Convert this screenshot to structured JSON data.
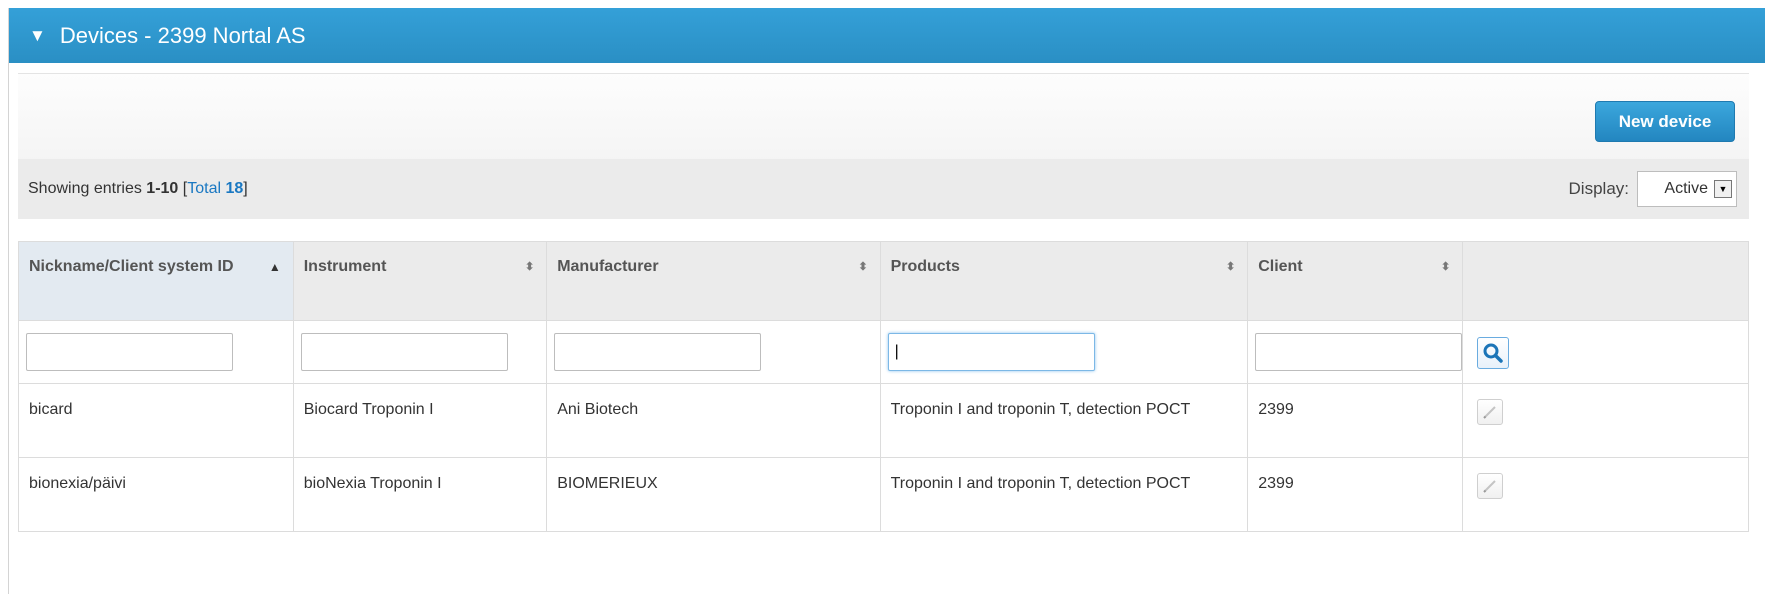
{
  "panel": {
    "title": "Devices - 2399 Nortal AS"
  },
  "toolbar": {
    "new_device_label": "New device"
  },
  "info": {
    "showing_prefix": "Showing entries ",
    "range": "1-10",
    "total_open": " [",
    "total_label": "Total ",
    "total_count": "18",
    "total_close": "]"
  },
  "display": {
    "label": "Display:",
    "selected": "Active"
  },
  "table": {
    "headers": {
      "nickname": "Nickname/Client system ID",
      "instrument": "Instrument",
      "manufacturer": "Manufacturer",
      "products": "Products",
      "client": "Client"
    },
    "filters": {
      "nickname": "",
      "instrument": "",
      "manufacturer": "",
      "products": "|",
      "client": ""
    },
    "rows": [
      {
        "nickname": "bicard",
        "instrument": "Biocard Troponin I",
        "manufacturer": "Ani Biotech",
        "products": "Troponin I and troponin T, detection POCT",
        "client": "2399"
      },
      {
        "nickname": "bionexia/päivi",
        "instrument": "bioNexia Troponin I",
        "manufacturer": "BIOMERIEUX",
        "products": "Troponin I and troponin T, detection POCT",
        "client": "2399"
      }
    ]
  },
  "icons": {
    "collapse": "triangle-down-icon",
    "search": "search-icon",
    "edit": "pencil-icon",
    "sort_asc": "sort-asc-icon",
    "sort_both": "sort-both-icon"
  },
  "colors": {
    "header_bg": "#2e97ce",
    "button_bg": "#2a8fc8",
    "link": "#1a78c2"
  }
}
